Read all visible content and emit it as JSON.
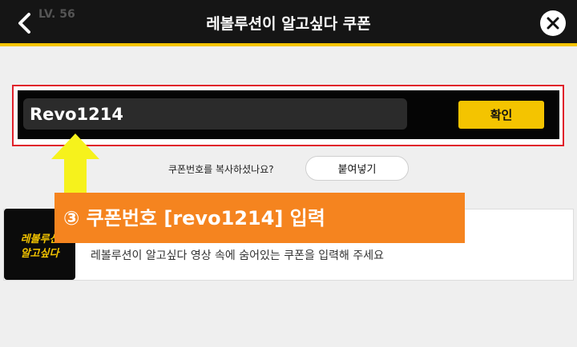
{
  "header": {
    "title": "레볼루션이 알고싶다 쿠폰",
    "level_text": "LV. 56",
    "back_icon": "chevron-left-icon",
    "close_icon": "close-icon"
  },
  "coupon_form": {
    "input_value": "Revo1214",
    "confirm_label": "확인",
    "copy_question": "쿠폰번호를 복사하셨나요?",
    "paste_label": "붙여넣기"
  },
  "coupon_item": {
    "thumb_line1": "레볼루션",
    "thumb_line2": "알고싶다",
    "description": "레볼루션이 알고싶다 영상 속에 숨어있는 쿠폰을 입력해 주세요"
  },
  "annotation": {
    "text": "③ 쿠폰번호 [revo1214] 입력",
    "arrow_icon": "up-arrow-icon"
  },
  "colors": {
    "accent": "#f4c400",
    "callout": "#f5841f",
    "highlight_border": "#e0202a",
    "arrow": "#f6f21c"
  }
}
